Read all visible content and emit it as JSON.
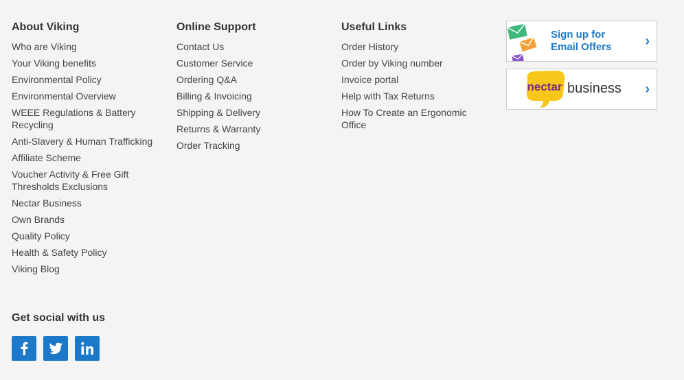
{
  "about": {
    "heading": "About Viking",
    "links": [
      "Who are Viking",
      "Your Viking benefits",
      "Environmental Policy",
      "Environmental Overview",
      "WEEE Regulations & Battery Recycling",
      "Anti-Slavery & Human Trafficking",
      "Affiliate Scheme",
      "Voucher Activity & Free Gift Thresholds Exclusions",
      "Nectar Business",
      "Own Brands",
      "Quality Policy",
      "Health & Safety Policy",
      "Viking Blog"
    ]
  },
  "support": {
    "heading": "Online Support",
    "links": [
      "Contact Us",
      "Customer Service",
      "Ordering Q&A",
      "Billing & Invoicing",
      "Shipping & Delivery",
      "Returns & Warranty",
      "Order Tracking"
    ]
  },
  "useful": {
    "heading": "Useful Links",
    "links": [
      "Order History",
      "Order by Viking number",
      "Invoice portal",
      "Help with Tax Returns",
      "How To Create an Ergonomic Office"
    ]
  },
  "promos": {
    "email": {
      "line1": "Sign up for",
      "line2": "Email Offers",
      "icon": "envelopes-icon"
    },
    "nectar": {
      "logo_text": "nectar",
      "label": "business"
    },
    "chevron": "›"
  },
  "social": {
    "heading": "Get social with us",
    "networks": [
      "facebook",
      "twitter",
      "linkedin"
    ]
  },
  "colors": {
    "accent": "#1c79c9",
    "background": "#f4f4f4",
    "nectar_yellow": "#f7c71a",
    "nectar_purple": "#7a2a86"
  }
}
